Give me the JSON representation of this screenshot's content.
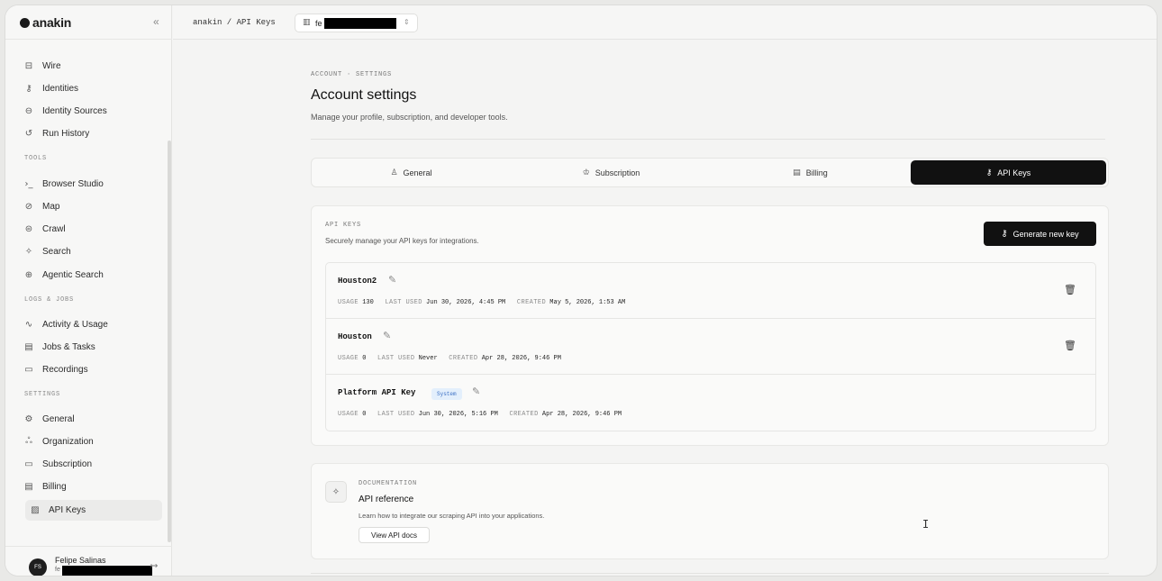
{
  "app": {
    "logo_text": "anakin",
    "collapse_glyph": "«"
  },
  "sidebar": {
    "top_items": [
      {
        "icon": "wire-icon",
        "glyph": "⊟",
        "label": "Wire"
      },
      {
        "icon": "key-outline-icon",
        "glyph": "⚷",
        "label": "Identities"
      },
      {
        "icon": "identity-source-icon",
        "glyph": "⊖",
        "label": "Identity Sources"
      },
      {
        "icon": "history-icon",
        "glyph": "↺",
        "label": "Run History"
      }
    ],
    "tools_label": "TOOLS",
    "tools_items": [
      {
        "icon": "terminal-icon",
        "glyph": "›_",
        "label": "Browser Studio"
      },
      {
        "icon": "compass-icon",
        "glyph": "⊘",
        "label": "Map"
      },
      {
        "icon": "crawl-icon",
        "glyph": "⊜",
        "label": "Crawl"
      },
      {
        "icon": "sparkle-icon",
        "glyph": "✧",
        "label": "Search"
      },
      {
        "icon": "agentic-search-icon",
        "glyph": "⊕",
        "label": "Agentic Search"
      }
    ],
    "logs_label": "LOGS & JOBS",
    "logs_items": [
      {
        "icon": "activity-icon",
        "glyph": "∿",
        "label": "Activity & Usage"
      },
      {
        "icon": "jobs-icon",
        "glyph": "▤",
        "label": "Jobs & Tasks"
      },
      {
        "icon": "recording-icon",
        "glyph": "▭",
        "label": "Recordings"
      }
    ],
    "settings_label": "SETTINGS",
    "settings_items": [
      {
        "icon": "gear-icon",
        "glyph": "⚙",
        "label": "General"
      },
      {
        "icon": "organization-icon",
        "glyph": "ஃ",
        "label": "Organization"
      },
      {
        "icon": "card-icon",
        "glyph": "▭",
        "label": "Subscription"
      },
      {
        "icon": "receipt-icon",
        "glyph": "▤",
        "label": "Billing"
      },
      {
        "icon": "api-key-icon",
        "glyph": "▨",
        "label": "API Keys"
      }
    ],
    "active_item": "API Keys"
  },
  "user": {
    "initials": "FS",
    "name": "Felipe Salinas",
    "email_prefix": "fe",
    "logout_glyph": "↦"
  },
  "topbar": {
    "breadcrumb": "anakin / API Keys",
    "org_prefix": "fe",
    "org_chevron": "⇕"
  },
  "header": {
    "eyebrow": "ACCOUNT · SETTINGS",
    "title": "Account settings",
    "subtitle": "Manage your profile, subscription, and developer tools."
  },
  "tabs": [
    {
      "label": "General",
      "icon": "user-icon",
      "glyph": "♙"
    },
    {
      "label": "Subscription",
      "icon": "crown-icon",
      "glyph": "♔"
    },
    {
      "label": "Billing",
      "icon": "receipt-icon",
      "glyph": "▤"
    },
    {
      "label": "API Keys",
      "icon": "key-icon",
      "glyph": "⚷"
    }
  ],
  "api_keys": {
    "eyebrow": "API KEYS",
    "description": "Securely manage your API keys for integrations.",
    "generate_label": "Generate new key",
    "generate_glyph": "⚷",
    "meta_labels": {
      "usage": "USAGE",
      "last_used": "LAST USED",
      "created": "CREATED"
    },
    "keys": [
      {
        "name": "Houston2",
        "usage": "130",
        "last_used": "Jun 30, 2026, 4:45 PM",
        "created": "May 5, 2026, 1:53 AM",
        "badge": "",
        "deletable": true
      },
      {
        "name": "Houston",
        "usage": "0",
        "last_used": "Never",
        "created": "Apr 28, 2026, 9:46 PM",
        "badge": "",
        "deletable": true
      },
      {
        "name": "Platform API Key",
        "usage": "0",
        "last_used": "Jun 30, 2026, 5:16 PM",
        "created": "Apr 28, 2026, 9:46 PM",
        "badge": "System",
        "deletable": false
      }
    ]
  },
  "docs": {
    "eyebrow": "DOCUMENTATION",
    "title": "API reference",
    "description": "Learn how to integrate our scraping API into your applications.",
    "button_label": "View API docs",
    "glyph": "✧"
  },
  "colors": {
    "accent": "#111111",
    "badge_bg": "#e3effc",
    "badge_text": "#3a6fc4",
    "page_bg": "#f4f4f3"
  }
}
